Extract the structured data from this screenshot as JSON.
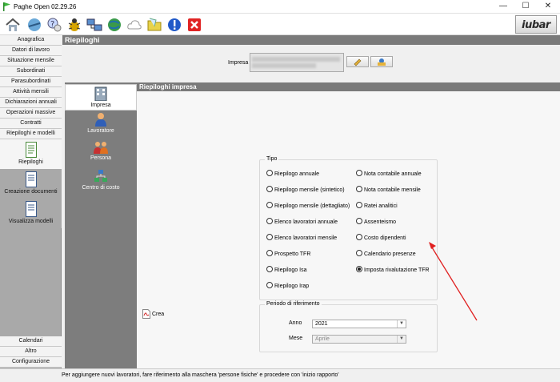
{
  "window": {
    "title": "Paghe Open 02.29.26",
    "min": "—",
    "max": "☐",
    "close": "✕"
  },
  "toolbar": {
    "logo": "iubar",
    "icons": [
      "home-icon",
      "network-icon",
      "help-icon",
      "bug-icon",
      "computers-icon",
      "globe-icon",
      "cloud-icon",
      "folder-icon",
      "info-icon",
      "exit-icon"
    ]
  },
  "nav": {
    "items_top": [
      "Anagrafica",
      "Datori di lavoro",
      "Situazione mensile",
      "Subordinati",
      "Parasubordinati",
      "Attività mensili",
      "Dichiarazioni annuali",
      "Operazioni massive",
      "Contratti",
      "Riepiloghi e modelli"
    ],
    "big": [
      "Riepiloghi",
      "Creazione documenti",
      "Visualizza modelli"
    ],
    "items_bottom": [
      "Calendari",
      "Altro",
      "Configurazione"
    ]
  },
  "header": {
    "title": "Riepiloghi",
    "impresa_label": "Impresa"
  },
  "sub": {
    "items": [
      "Impresa",
      "Lavoratore",
      "Persona",
      "Centro di costo"
    ]
  },
  "content": {
    "title": "Riepiloghi impresa",
    "tipo_legend": "Tipo",
    "options_left": [
      "Riepilogo annuale",
      "Riepilogo mensile (sintetico)",
      "Riepilogo mensile (dettagliato)",
      "Elenco lavoratori annuale",
      "Elenco lavoratori mensile",
      "Prospetto TFR",
      "Riepilogo Isa",
      "Riepilogo Irap"
    ],
    "options_right": [
      "Nota contabile annuale",
      "Nota contabile mensile",
      "Ratei analitici",
      "Assenteismo",
      "Costo dipendenti",
      "Calendario presenze",
      "Imposta rivalutazione TFR"
    ],
    "selected": "Imposta rivalutazione TFR",
    "periodo_legend": "Periodo di riferimento",
    "anno_label": "Anno",
    "anno_value": "2021",
    "mese_label": "Mese",
    "mese_value": "Aprile",
    "crea_label": "Crea"
  },
  "status": {
    "message": "Per aggiungere nuovi lavoratori, fare riferimento alla maschera 'persone fisiche' e procedere con 'inizio rapporto'"
  },
  "colors": {
    "header_gray": "#7a7a7a",
    "nav_gray": "#a9a9a9",
    "arrow_red": "#e02020"
  }
}
